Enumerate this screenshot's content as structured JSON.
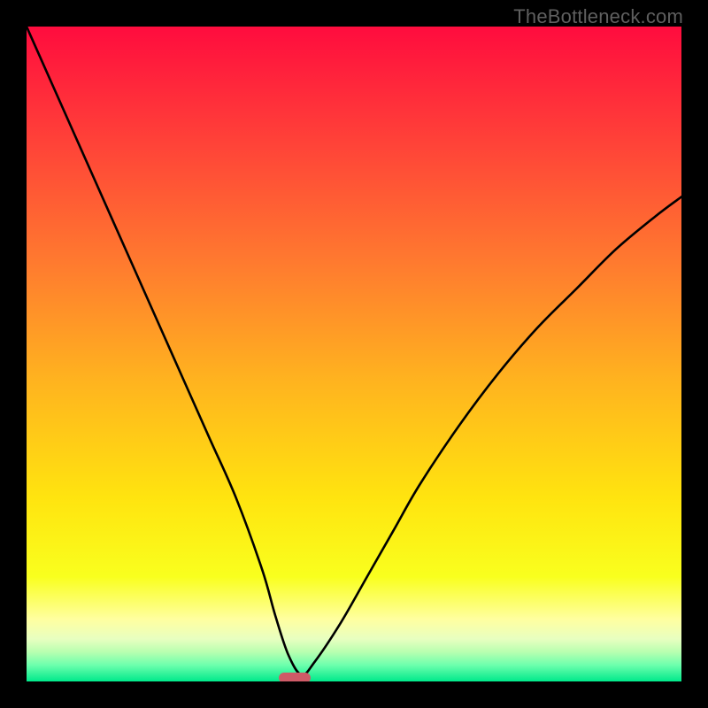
{
  "watermark": "TheBottleneck.com",
  "colors": {
    "frame": "#000000",
    "curve": "#000000",
    "marker": "#cf5b67",
    "gradient_stops": [
      {
        "offset": 0.0,
        "color": "#ff0c3e"
      },
      {
        "offset": 0.18,
        "color": "#ff4338"
      },
      {
        "offset": 0.36,
        "color": "#ff7a2f"
      },
      {
        "offset": 0.54,
        "color": "#ffb31f"
      },
      {
        "offset": 0.72,
        "color": "#ffe40f"
      },
      {
        "offset": 0.84,
        "color": "#f9ff1e"
      },
      {
        "offset": 0.905,
        "color": "#ffffa0"
      },
      {
        "offset": 0.935,
        "color": "#e8ffc0"
      },
      {
        "offset": 0.955,
        "color": "#b8ffb0"
      },
      {
        "offset": 0.975,
        "color": "#6dffad"
      },
      {
        "offset": 1.0,
        "color": "#00e98b"
      }
    ]
  },
  "chart_data": {
    "type": "line",
    "title": "",
    "xlabel": "",
    "ylabel": "",
    "xlim": [
      0,
      100
    ],
    "ylim": [
      0,
      100
    ],
    "grid": false,
    "legend": false,
    "series": [
      {
        "name": "bottleneck-curve",
        "x": [
          0,
          4,
          8,
          12,
          16,
          20,
          24,
          28,
          32,
          36,
          38,
          40,
          42,
          44,
          48,
          52,
          56,
          60,
          66,
          72,
          78,
          84,
          90,
          96,
          100
        ],
        "y": [
          100,
          91,
          82,
          73,
          64,
          55,
          46,
          37,
          28,
          17,
          10,
          4,
          1,
          3,
          9,
          16,
          23,
          30,
          39,
          47,
          54,
          60,
          66,
          71,
          74
        ]
      }
    ],
    "annotations": [
      {
        "name": "min-marker",
        "x": 41,
        "y": 0.5,
        "shape": "rounded-bar",
        "color": "#cf5b67"
      }
    ],
    "notes": "Background is a vertical red→orange→yellow→green gradient; y-values are approximate percentages read from the plot height."
  }
}
